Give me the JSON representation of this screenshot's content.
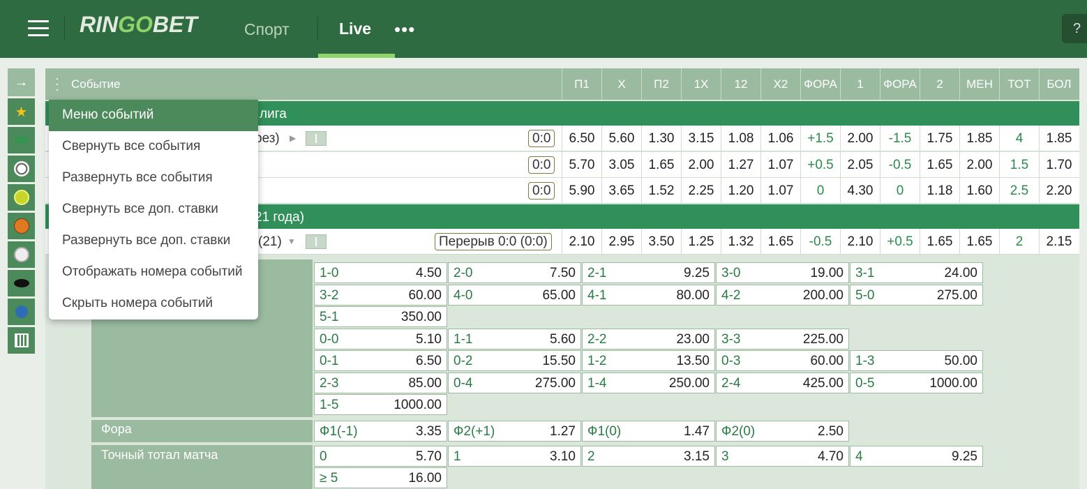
{
  "header": {
    "logo_a": "RIN",
    "logo_go": "GO",
    "logo_b": "BET",
    "nav_sport": "Спорт",
    "nav_live": "Live",
    "nav_more": "•••",
    "help": "?"
  },
  "table": {
    "event_col": "Событие",
    "columns": [
      "П1",
      "Х",
      "П2",
      "1Х",
      "12",
      "Х2",
      "ФОРА",
      "1",
      "ФОРА",
      "2",
      "МЕН",
      "ТОТ",
      "БОЛ"
    ]
  },
  "leagues": [
    {
      "name": "лига"
    },
    {
      "name": "21 года)"
    }
  ],
  "events": [
    {
      "name": "рез)",
      "score": "0:0",
      "odds": [
        "6.50",
        "5.60",
        "1.30",
        "3.15",
        "1.08",
        "1.06",
        "+1.5",
        "2.00",
        "-1.5",
        "1.75",
        "1.85",
        "4",
        "1.85"
      ]
    },
    {
      "name": "",
      "score": "0:0",
      "odds": [
        "5.70",
        "3.05",
        "1.65",
        "2.00",
        "1.27",
        "1.07",
        "+0.5",
        "2.05",
        "-0.5",
        "1.65",
        "2.00",
        "1.5",
        "1.70"
      ]
    },
    {
      "name": "",
      "score": "0:0",
      "odds": [
        "5.90",
        "3.65",
        "1.52",
        "2.25",
        "1.20",
        "1.07",
        "0",
        "4.30",
        "0",
        "1.18",
        "1.60",
        "2.5",
        "2.20"
      ]
    },
    {
      "name": "(21)",
      "score": "Перерыв 0:0 (0:0)",
      "odds": [
        "2.10",
        "2.95",
        "3.50",
        "1.25",
        "1.32",
        "1.65",
        "-0.5",
        "2.10",
        "+0.5",
        "1.65",
        "1.65",
        "2",
        "2.15"
      ]
    }
  ],
  "menu": {
    "items": [
      "Меню событий",
      "Свернуть все события",
      "Развернуть все события",
      "Свернуть все доп. ставки",
      "Развернуть все доп. ставки",
      "Отображать номера событий",
      "Скрыть номера событий"
    ]
  },
  "extra": {
    "score_rows": [
      [
        [
          "1-0",
          "4.50"
        ],
        [
          "2-0",
          "7.50"
        ],
        [
          "2-1",
          "9.25"
        ],
        [
          "3-0",
          "19.00"
        ],
        [
          "3-1",
          "24.00"
        ]
      ],
      [
        [
          "3-2",
          "60.00"
        ],
        [
          "4-0",
          "65.00"
        ],
        [
          "4-1",
          "80.00"
        ],
        [
          "4-2",
          "200.00"
        ],
        [
          "5-0",
          "275.00"
        ]
      ],
      [
        [
          "5-1",
          "350.00"
        ]
      ],
      [
        [
          "0-0",
          "5.10"
        ],
        [
          "1-1",
          "5.60"
        ],
        [
          "2-2",
          "23.00"
        ],
        [
          "3-3",
          "225.00"
        ]
      ],
      [
        [
          "0-1",
          "6.50"
        ],
        [
          "0-2",
          "15.50"
        ],
        [
          "1-2",
          "13.50"
        ],
        [
          "0-3",
          "60.00"
        ],
        [
          "1-3",
          "50.00"
        ]
      ],
      [
        [
          "2-3",
          "85.00"
        ],
        [
          "0-4",
          "275.00"
        ],
        [
          "1-4",
          "250.00"
        ],
        [
          "2-4",
          "425.00"
        ],
        [
          "0-5",
          "1000.00"
        ]
      ],
      [
        [
          "1-5",
          "1000.00"
        ]
      ]
    ],
    "handicap_label": "Фора",
    "handicap": [
      [
        "Ф1(-1)",
        "3.35"
      ],
      [
        "Ф2(+1)",
        "1.27"
      ],
      [
        "Ф1(0)",
        "1.47"
      ],
      [
        "Ф2(0)",
        "2.50"
      ]
    ],
    "total_label": "Точный тотал матча",
    "total_rows": [
      [
        [
          "0",
          "5.70"
        ],
        [
          "1",
          "3.10"
        ],
        [
          "2",
          "3.15"
        ],
        [
          "3",
          "4.70"
        ],
        [
          "4",
          "9.25"
        ]
      ],
      [
        [
          "≥ 5",
          "16.00"
        ]
      ]
    ]
  },
  "colors": {
    "header": "#2f6b41",
    "league": "#31905a",
    "accent": "#8fd36a",
    "menu_active": "#4d8a5b"
  }
}
